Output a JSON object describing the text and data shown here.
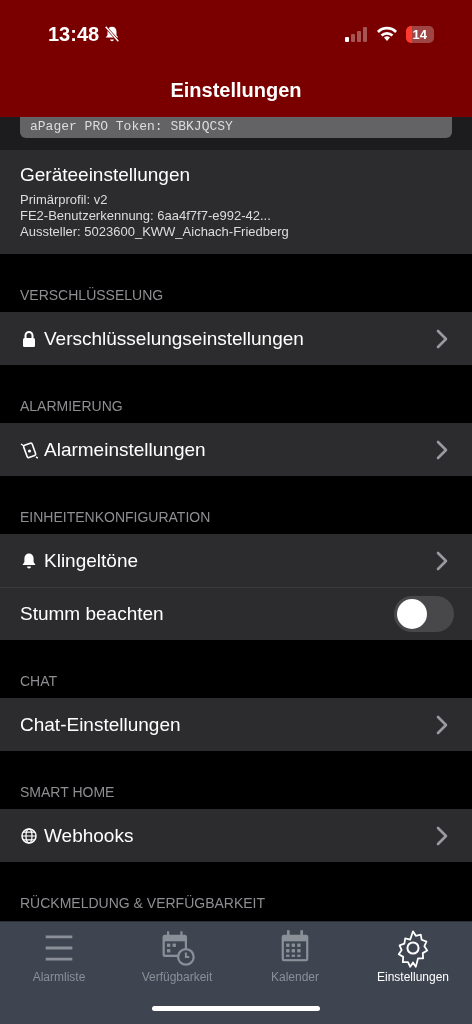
{
  "status_bar": {
    "time": "13:48",
    "battery": "14",
    "battery_low": true
  },
  "nav_bar": {
    "title": "Einstellungen"
  },
  "token": {
    "text": "aPager PRO Token: SBKJQCSY"
  },
  "device": {
    "title": "Geräteeinstellungen",
    "lines": [
      "Primärprofil: v2",
      "FE2-Benutzerkennung: 6aa4f7f7-e992-42...",
      "Aussteller: 5023600_KWW_Aichach-Friedberg"
    ]
  },
  "sections": [
    {
      "header": "VERSCHLÜSSELUNG",
      "rows": [
        {
          "kind": "link",
          "label": "Verschlüsselungseinstellungen"
        }
      ]
    },
    {
      "header": "ALARMIERUNG",
      "rows": [
        {
          "kind": "link",
          "label": "Alarmeinstellungen"
        }
      ]
    },
    {
      "header": "EINHEITENKONFIGURATION",
      "rows": [
        {
          "kind": "link",
          "label": "Klingeltöne"
        },
        {
          "kind": "toggle",
          "label": "Stumm beachten",
          "on": false
        }
      ]
    },
    {
      "header": "CHAT",
      "rows": [
        {
          "kind": "link",
          "label": "Chat-Einstellungen"
        }
      ]
    },
    {
      "header": "SMART HOME",
      "rows": [
        {
          "kind": "link",
          "label": "Webhooks"
        }
      ]
    },
    {
      "header": "RÜCKMELDUNG & VERFÜGBARKEIT"
    }
  ],
  "tab_bar": [
    {
      "label": "Alarmliste",
      "selected": false
    },
    {
      "label": "Verfügbarkeit",
      "selected": false
    },
    {
      "label": "Kalender",
      "selected": false
    },
    {
      "label": "Einstellungen",
      "selected": true
    }
  ]
}
